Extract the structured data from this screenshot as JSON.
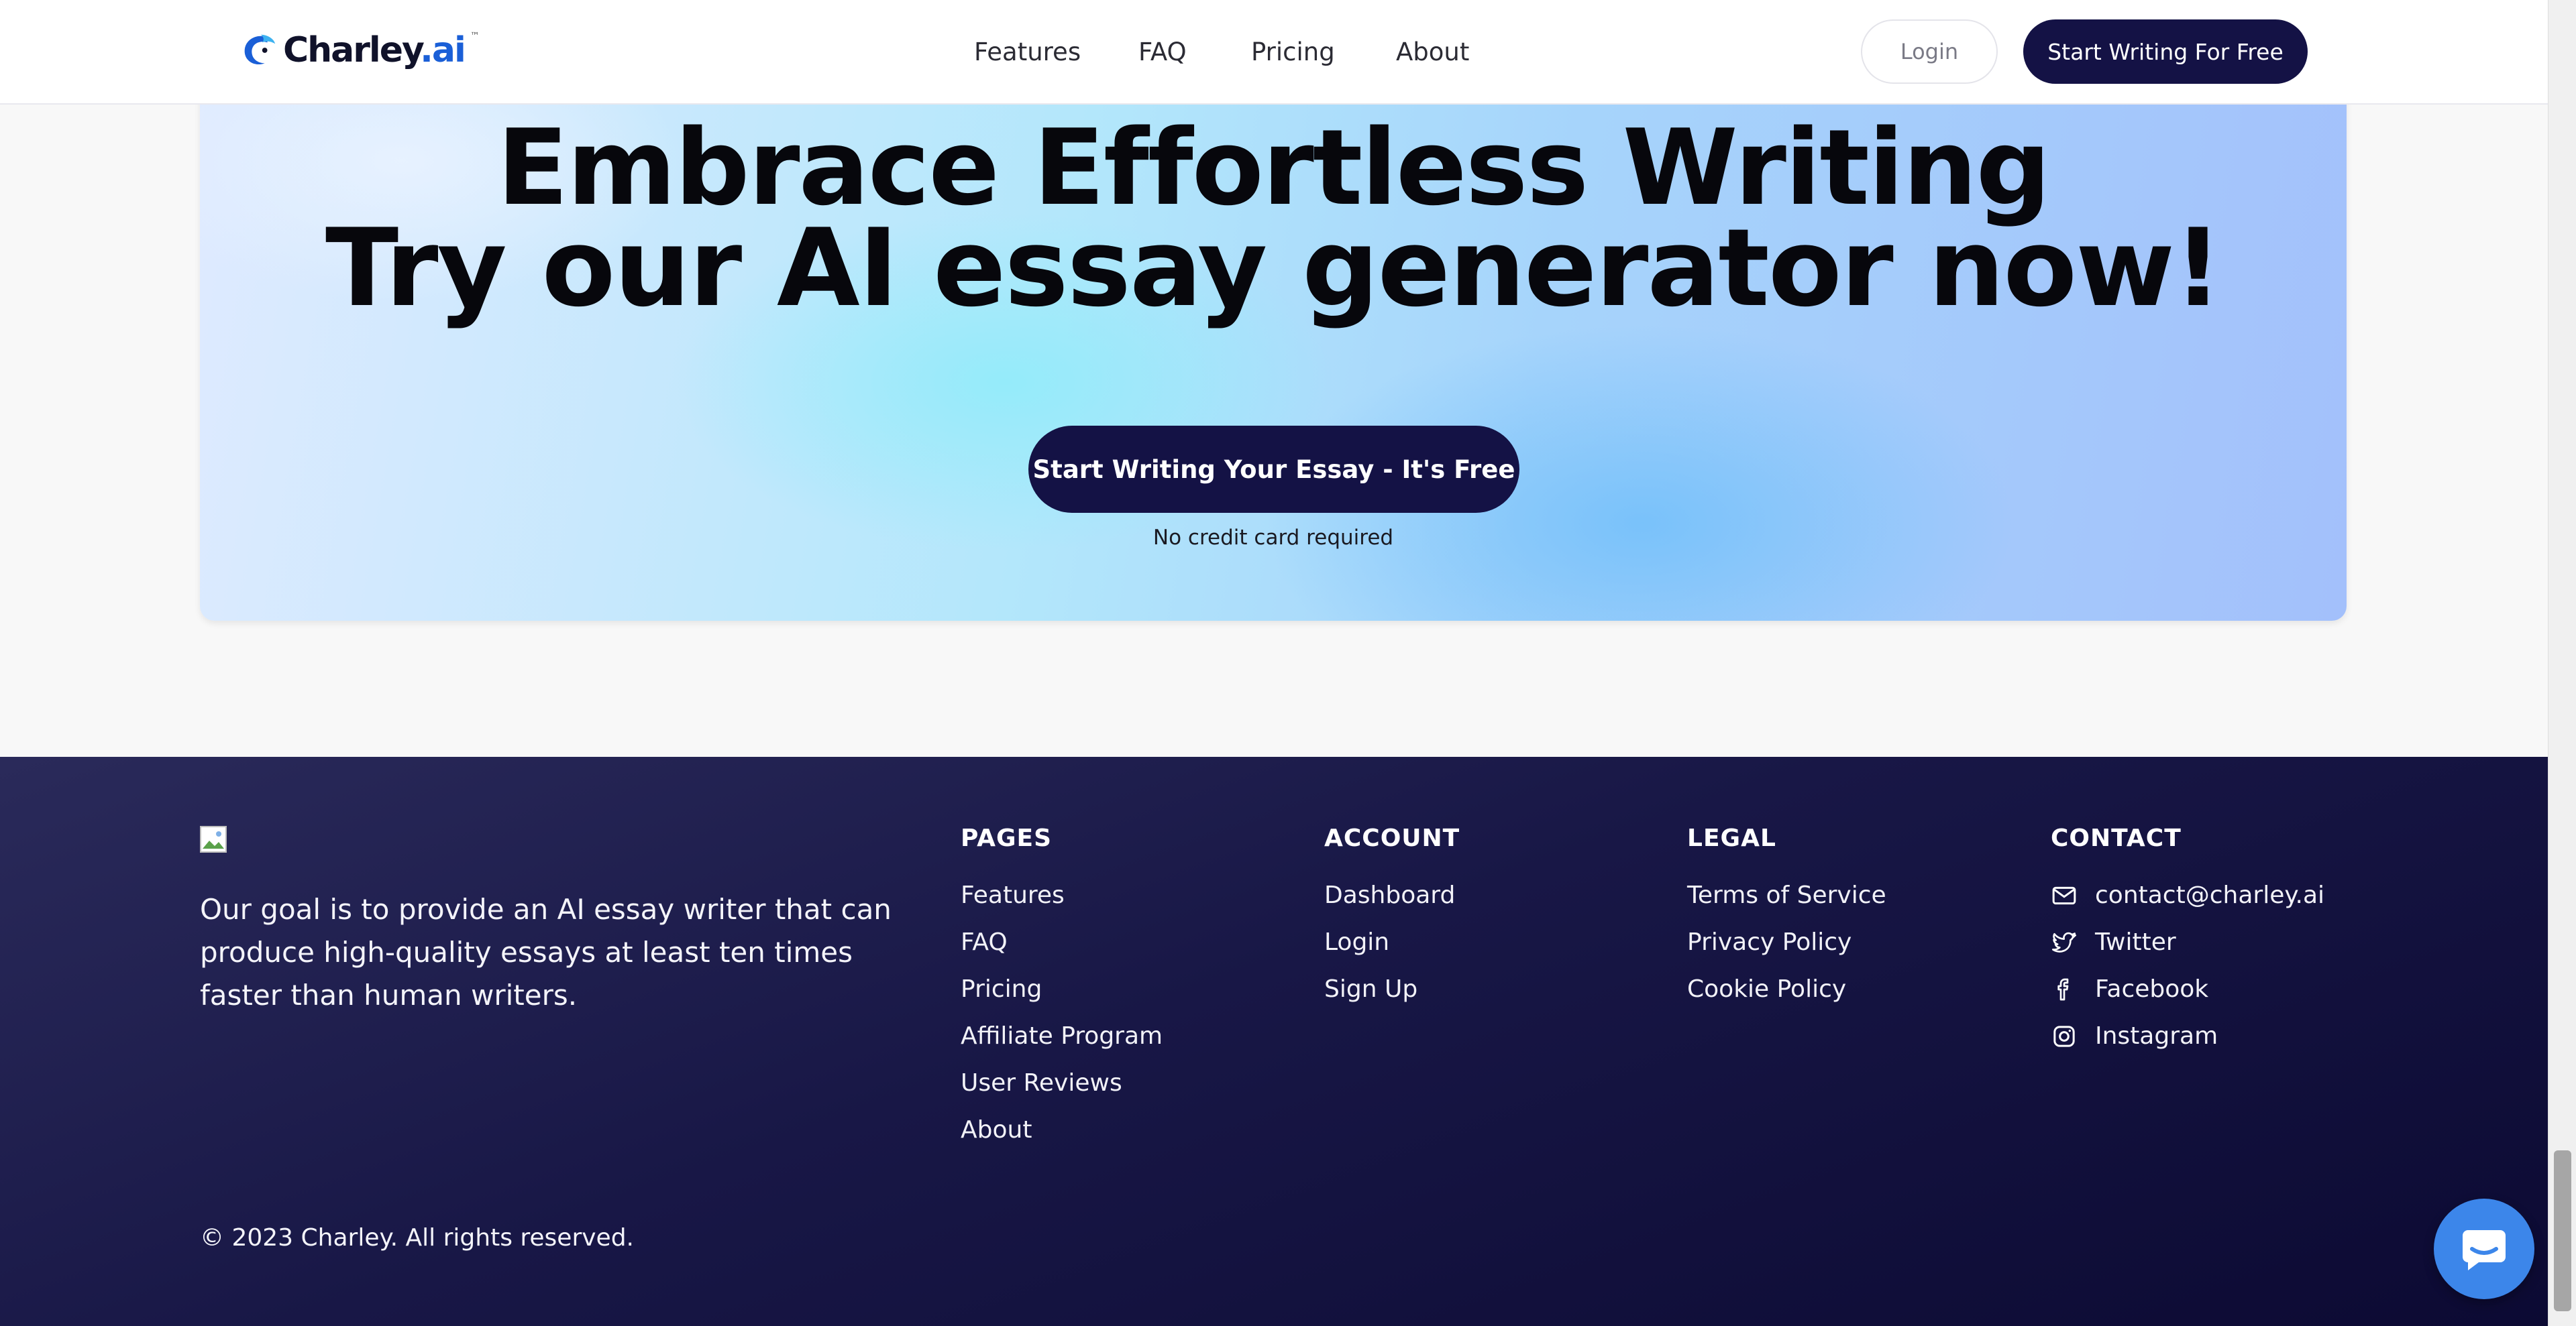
{
  "header": {
    "logo_word": "Charley",
    "logo_suffix": ".ai",
    "logo_tm": "™",
    "nav": [
      {
        "label": "Features"
      },
      {
        "label": "FAQ"
      },
      {
        "label": "Pricing"
      },
      {
        "label": "About"
      }
    ],
    "login_label": "Login",
    "start_label": "Start Writing For Free"
  },
  "hero": {
    "title_line1": "Embrace Effortless Writing",
    "title_line2": "Try our AI essay generator now!",
    "cta_label": "Start Writing Your Essay - It's Free",
    "note": "No credit card required"
  },
  "footer": {
    "mission": "Our goal is to provide an AI essay writer that can produce high-quality essays at least ten times faster than human writers.",
    "pages": {
      "heading": "PAGES",
      "items": [
        "Features",
        "FAQ",
        "Pricing",
        "Affiliate Program",
        "User Reviews",
        "About"
      ]
    },
    "account": {
      "heading": "ACCOUNT",
      "items": [
        "Dashboard",
        "Login",
        "Sign Up"
      ]
    },
    "legal": {
      "heading": "LEGAL",
      "items": [
        "Terms of Service",
        "Privacy Policy",
        "Cookie Policy"
      ]
    },
    "contact": {
      "heading": "CONTACT",
      "items": [
        {
          "label": "contact@charley.ai",
          "icon": "mail-icon"
        },
        {
          "label": "Twitter",
          "icon": "twitter-icon"
        },
        {
          "label": "Facebook",
          "icon": "facebook-icon"
        },
        {
          "label": "Instagram",
          "icon": "instagram-icon"
        }
      ]
    },
    "copyright": "© 2023 Charley. All rights reserved."
  },
  "colors": {
    "primary_dark": "#141245",
    "chat_blue": "#3c86ea",
    "footer_bg": "#181746"
  }
}
